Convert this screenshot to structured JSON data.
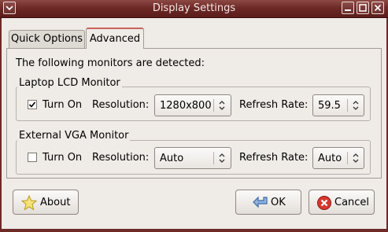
{
  "window": {
    "title": "Display Settings",
    "controls": [
      "menu",
      "minimize",
      "maximize",
      "close"
    ]
  },
  "tabs": [
    {
      "label": "Quick Options",
      "active": false
    },
    {
      "label": "Advanced",
      "active": true
    }
  ],
  "advanced": {
    "intro_text": "The following monitors are detected:",
    "monitors": [
      {
        "name": "Laptop LCD Monitor",
        "turn_on_label": "Turn On",
        "turn_on_checked": true,
        "resolution_label": "Resolution:",
        "resolution_value": "1280x800",
        "refresh_label": "Refresh Rate:",
        "refresh_value": "59.5"
      },
      {
        "name": "External VGA Monitor",
        "turn_on_label": "Turn On",
        "turn_on_checked": false,
        "resolution_label": "Resolution:",
        "resolution_value": "Auto",
        "refresh_label": "Refresh Rate:",
        "refresh_value": "Auto"
      }
    ]
  },
  "buttons": {
    "about": {
      "label": "About",
      "icon": "star-icon"
    },
    "ok": {
      "label": "OK",
      "icon": "back-arrow-icon"
    },
    "cancel": {
      "label": "Cancel",
      "icon": "cancel-icon"
    }
  },
  "colors": {
    "titlebar": "#6e2a27",
    "active_tab_accent": "#c9625c",
    "background": "#efebe7"
  }
}
